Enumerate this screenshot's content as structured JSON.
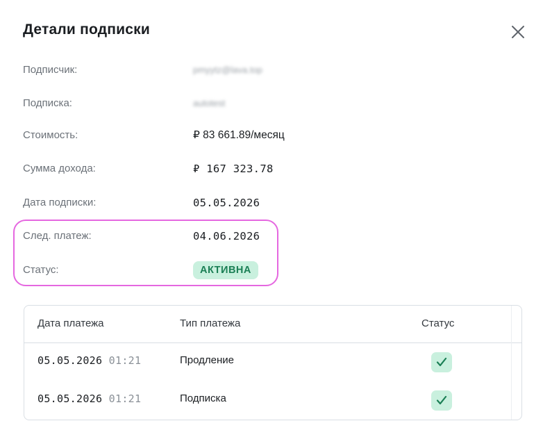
{
  "dialog": {
    "title": "Детали подписки",
    "close_icon": "close-icon"
  },
  "details": [
    {
      "label": "Подписчик:",
      "value": "pmyytz@lava.top",
      "redacted": true
    },
    {
      "label": "Подписка:",
      "value": "autotest",
      "redacted": true
    },
    {
      "label": "Стоимость:",
      "value": "₽ 83 661.89/месяц"
    },
    {
      "label": "Сумма дохода:",
      "value": "₽ 167 323.78"
    },
    {
      "label": "Дата подписки:",
      "value": "05.05.2026"
    },
    {
      "label": "След. платеж:",
      "value": "04.06.2026"
    },
    {
      "label": "Статус:",
      "value": "АКТИВНА"
    }
  ],
  "payments_table": {
    "headers": [
      "Дата платежа",
      "Тип платежа",
      "Статус"
    ],
    "rows": [
      {
        "date": "05.05.2026",
        "time": "01:21",
        "type": "Продление",
        "status_icon": "check-icon"
      },
      {
        "date": "05.05.2026",
        "time": "01:21",
        "type": "Подписка",
        "status_icon": "check-icon"
      }
    ]
  },
  "colors": {
    "highlight_border": "#e567e0",
    "status_badge_bg": "#c9f0de",
    "status_badge_text": "#1b7f55"
  }
}
